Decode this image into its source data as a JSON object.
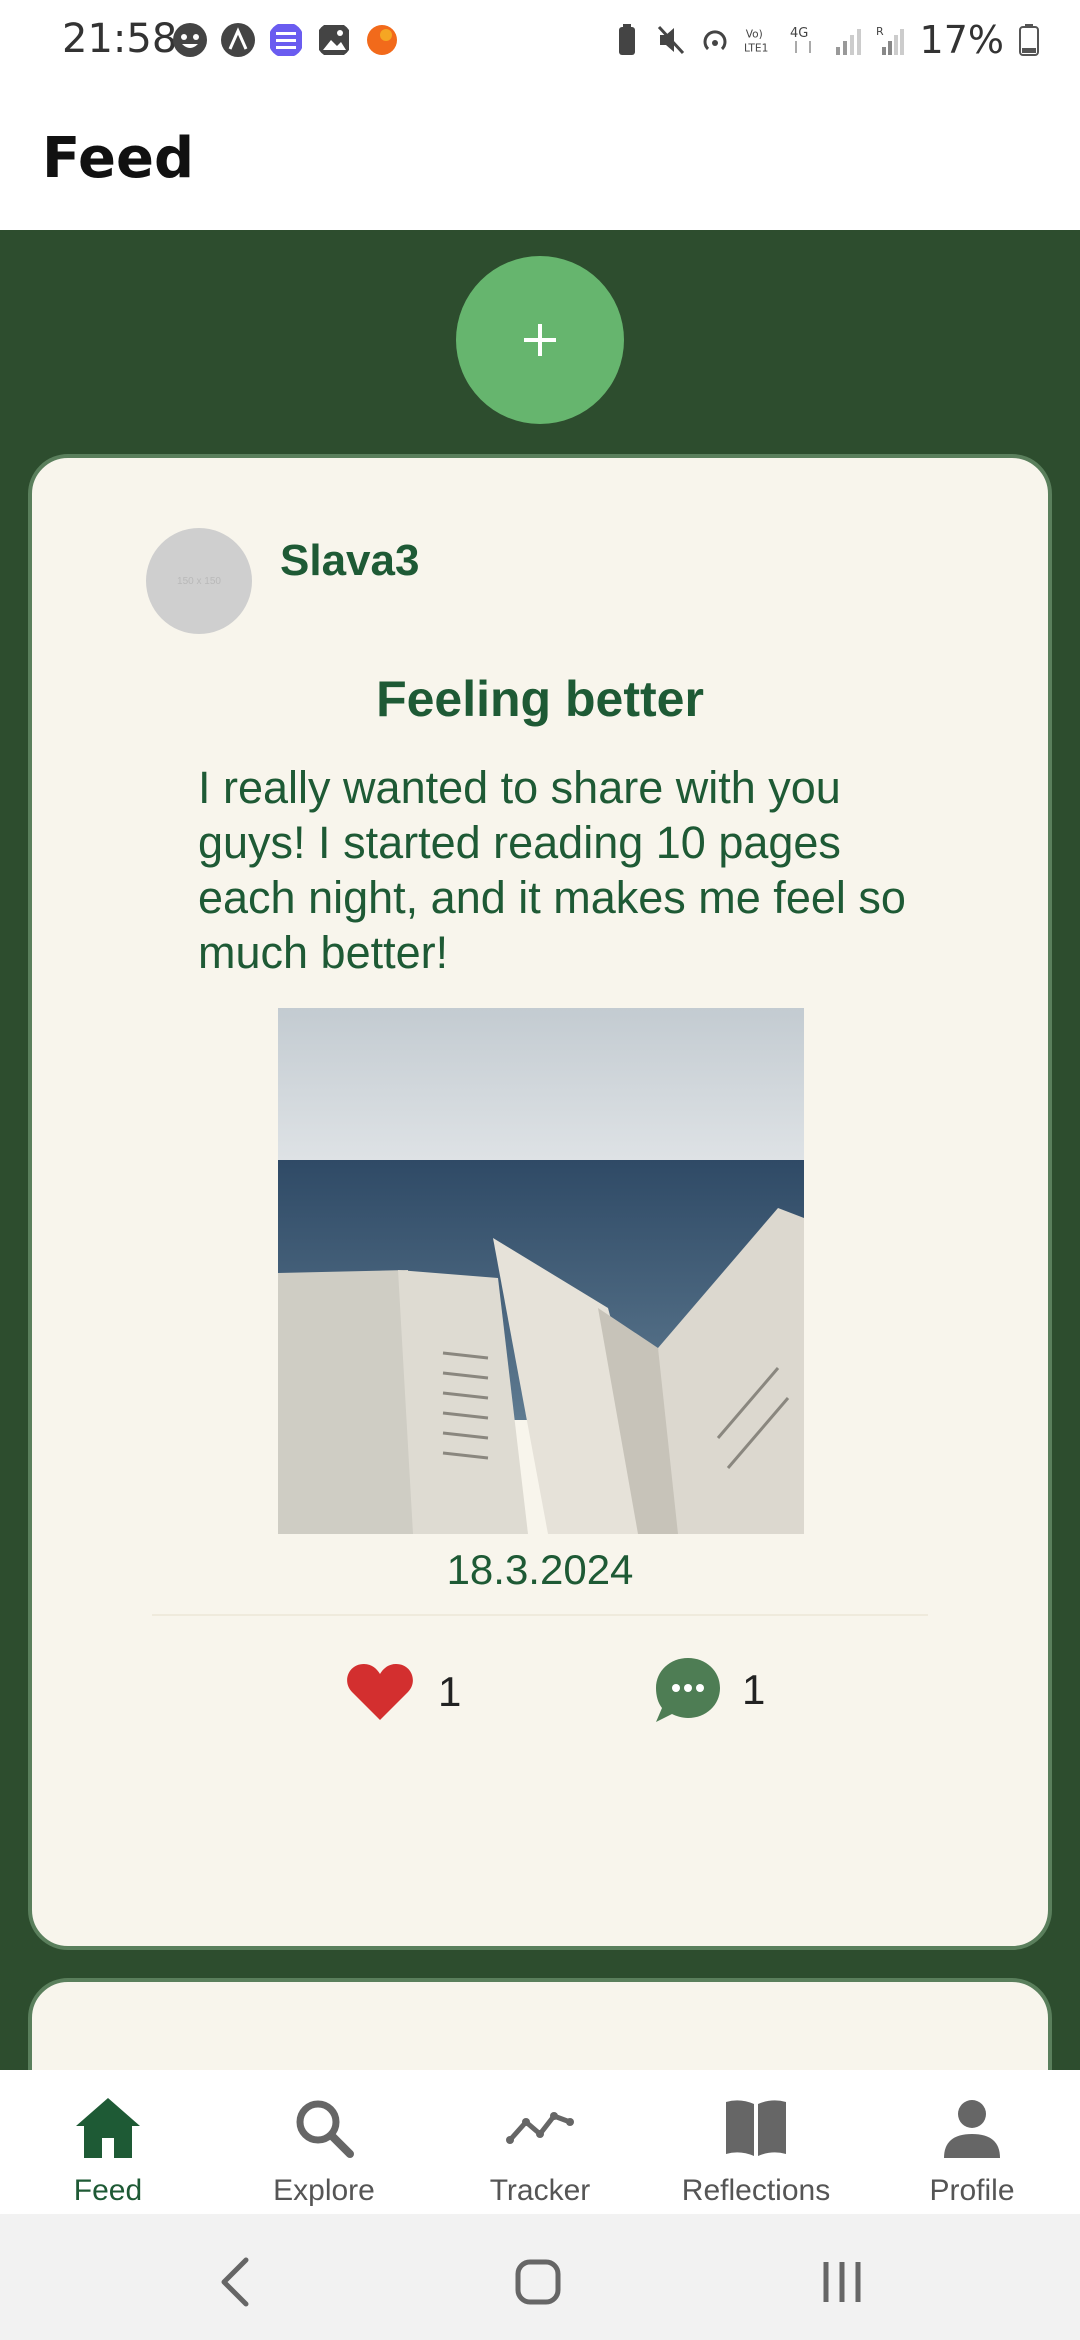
{
  "status_bar": {
    "time": "21:58",
    "battery": "17%",
    "icons": [
      "face-icon",
      "arch-icon",
      "list-icon",
      "image-icon",
      "orange-dot-icon",
      "battery-saver-icon",
      "mute-icon",
      "hotspot-icon",
      "volte-icon",
      "4g-icon",
      "signal-icon",
      "signal-r-icon",
      "battery-icon"
    ]
  },
  "header": {
    "title": "Feed"
  },
  "feed": {
    "add_button_icon": "plus-icon",
    "posts": [
      {
        "username": "Slava3",
        "avatar_placeholder": "150 x 150",
        "title": "Feeling better",
        "body": "I really wanted to share with you guys! I started reading 10 pages each night, and it makes me feel so much better!",
        "date": "18.3.2024",
        "likes": "1",
        "comments": "1"
      }
    ]
  },
  "bottom_nav": {
    "items": [
      {
        "label": "Feed",
        "icon": "home-icon",
        "active": true
      },
      {
        "label": "Explore",
        "icon": "search-icon",
        "active": false
      },
      {
        "label": "Tracker",
        "icon": "trend-line-icon",
        "active": false
      },
      {
        "label": "Reflections",
        "icon": "book-icon",
        "active": false
      },
      {
        "label": "Profile",
        "icon": "person-icon",
        "active": false
      }
    ]
  },
  "colors": {
    "feed_bg": "#2d4d2e",
    "card_bg": "#f8f5ec",
    "accent_green": "#1e5a35",
    "add_button": "#66b56e",
    "heart": "#d32f2f",
    "comment_bubble": "#4e7d54"
  }
}
